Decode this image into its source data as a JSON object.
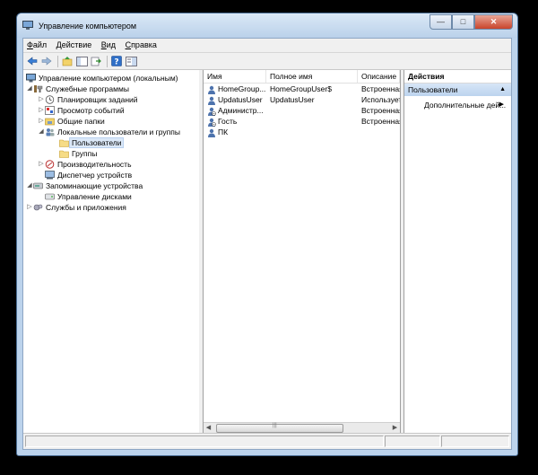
{
  "window": {
    "title": "Управление компьютером"
  },
  "caption": {
    "minimize": "—",
    "maximize": "□",
    "close": "✕"
  },
  "menu": [
    {
      "label": "Файл",
      "accel": "Ф",
      "rest": "айл"
    },
    {
      "label": "Действие",
      "accel": "Д",
      "rest": "ействие"
    },
    {
      "label": "Вид",
      "accel": "В",
      "rest": "ид"
    },
    {
      "label": "Справка",
      "accel": "С",
      "rest": "правка"
    }
  ],
  "toolbar": {
    "icons": [
      "back-arrow-icon",
      "forward-arrow-icon",
      "up-folder-icon",
      "show-hide-tree-icon",
      "export-list-icon",
      "help-icon",
      "properties-icon"
    ]
  },
  "tree": {
    "root": "Управление компьютером (локальным)",
    "items": [
      {
        "label": "Служебные программы",
        "level": 1,
        "expander": "◢"
      },
      {
        "label": "Планировщик заданий",
        "level": 2,
        "expander": "▷"
      },
      {
        "label": "Просмотр событий",
        "level": 2,
        "expander": "▷"
      },
      {
        "label": "Общие папки",
        "level": 2,
        "expander": "▷"
      },
      {
        "label": "Локальные пользователи и группы",
        "level": 2,
        "expander": "◢"
      },
      {
        "label": "Пользователи",
        "level": 3,
        "expander": "",
        "selected": true
      },
      {
        "label": "Группы",
        "level": 3,
        "expander": ""
      },
      {
        "label": "Производительность",
        "level": 2,
        "expander": "▷"
      },
      {
        "label": "Диспетчер устройств",
        "level": 2,
        "expander": ""
      },
      {
        "label": "Запоминающие устройства",
        "level": 1,
        "expander": "◢"
      },
      {
        "label": "Управление дисками",
        "level": 2,
        "expander": ""
      },
      {
        "label": "Службы и приложения",
        "level": 1,
        "expander": "▷"
      }
    ]
  },
  "list": {
    "columns": [
      "Имя",
      "Полное имя",
      "Описание"
    ],
    "rows": [
      {
        "name": "HomeGroup...",
        "fullname": "HomeGroupUser$",
        "description": "Встроенная"
      },
      {
        "name": "UpdatusUser",
        "fullname": "UpdatusUser",
        "description": "Использует"
      },
      {
        "name": "Администр...",
        "fullname": "",
        "description": "Встроенная"
      },
      {
        "name": "Гость",
        "fullname": "",
        "description": "Встроенная"
      },
      {
        "name": "ПК",
        "fullname": "",
        "description": ""
      }
    ]
  },
  "scroll": {
    "left": "◀",
    "right": "▶",
    "grip": "|||"
  },
  "actions": {
    "header": "Действия",
    "section": "Пользователи",
    "section_arrow": "▲",
    "item": "Дополнительные дей...",
    "item_arrow": "▶"
  }
}
